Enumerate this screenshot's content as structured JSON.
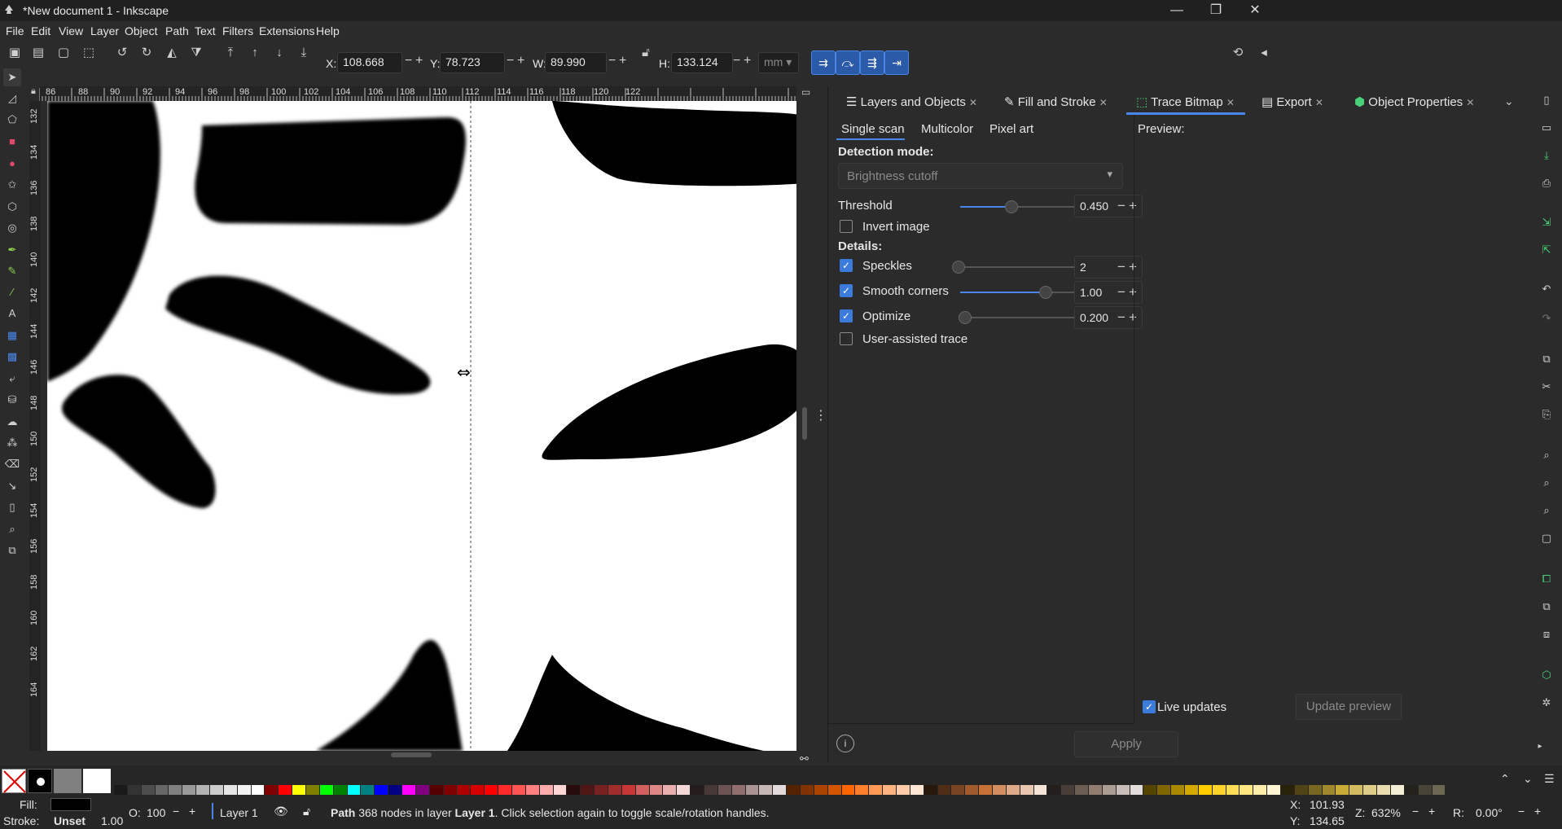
{
  "window": {
    "title": "*New document 1 - Inkscape",
    "minimize_glyph": "—",
    "restore_glyph": "❐",
    "close_glyph": "✕"
  },
  "menu": [
    "File",
    "Edit",
    "View",
    "Layer",
    "Object",
    "Path",
    "Text",
    "Filters",
    "Extensions",
    "Help"
  ],
  "toolbar": {
    "x_label": "X:",
    "x_value": "108.668",
    "y_label": "Y:",
    "y_value": "78.723",
    "w_label": "W:",
    "w_value": "89.990",
    "h_label": "H:",
    "h_value": "133.124",
    "unit": "mm",
    "minus": "−",
    "plus": "+"
  },
  "ruler": {
    "h_labels": [
      "86",
      "88",
      "90",
      "92",
      "94",
      "96",
      "98",
      "100",
      "102",
      "104",
      "106",
      "108",
      "110",
      "112",
      "114",
      "116",
      "118",
      "120",
      "122"
    ],
    "v_labels": [
      "132",
      "134",
      "136",
      "138",
      "140",
      "142",
      "144",
      "146",
      "148",
      "150",
      "152",
      "154",
      "156",
      "158",
      "160",
      "162",
      "164"
    ]
  },
  "panel": {
    "tabs": [
      {
        "label": "Layers and Objects",
        "icon": "layers-icon"
      },
      {
        "label": "Fill and Stroke",
        "icon": "fill-stroke-icon"
      },
      {
        "label": "Trace Bitmap",
        "icon": "trace-bitmap-icon"
      },
      {
        "label": "Export",
        "icon": "export-icon"
      },
      {
        "label": "Object Properties",
        "icon": "object-properties-icon"
      }
    ],
    "close_glyph": "✕",
    "sub_tabs": [
      "Single scan",
      "Multicolor",
      "Pixel art"
    ],
    "detection_mode_label": "Detection mode:",
    "detection_mode_value": "Brightness cutoff",
    "threshold_label": "Threshold",
    "threshold_value": "0.450",
    "threshold_level": 0.45,
    "invert_label": "Invert image",
    "invert_checked": false,
    "details_label": "Details:",
    "speckles_label": "Speckles",
    "speckles_value": "2",
    "speckles_checked": true,
    "speckles_level": 0.0,
    "smooth_label": "Smooth corners",
    "smooth_value": "1.00",
    "smooth_checked": true,
    "smooth_level": 0.75,
    "optimize_label": "Optimize",
    "optimize_value": "0.200",
    "optimize_checked": true,
    "optimize_level": 0.04,
    "user_assisted_label": "User-assisted trace",
    "user_assisted_checked": false,
    "preview_label": "Preview:",
    "live_updates_label": "Live updates",
    "live_updates_checked": true,
    "update_preview_label": "Update preview",
    "apply_label": "Apply",
    "info_glyph": "i"
  },
  "status": {
    "fill_label": "Fill:",
    "stroke_label": "Stroke:",
    "stroke_value": "Unset",
    "stroke_width": "1.00",
    "opacity_label": "O:",
    "opacity_value": "100",
    "layer_name": "Layer 1",
    "message_bold1": "Path",
    "message_part1": " 368 nodes in layer ",
    "message_bold2": "Layer 1",
    "message_part2": ". Click selection again to toggle scale/rotation handles.",
    "x_label": "X:",
    "x_value": "101.93",
    "y_label": "Y:",
    "y_value": "134.65",
    "zoom_label": "Z:",
    "zoom_value": "632%",
    "rotate_label": "R:",
    "rotate_value": "0.00°"
  },
  "palette_colors": [
    "#1a1a1a",
    "#333333",
    "#4d4d4d",
    "#666666",
    "#808080",
    "#999999",
    "#b3b3b3",
    "#cccccc",
    "#e6e6e6",
    "#f2f2f2",
    "#ffffff",
    "#800000",
    "#ff0000",
    "#ffff00",
    "#808000",
    "#00ff00",
    "#008000",
    "#00ffff",
    "#008080",
    "#0000ff",
    "#000080",
    "#ff00ff",
    "#800080",
    "#550000",
    "#800000",
    "#aa0000",
    "#d40000",
    "#ff0000",
    "#ff2a2a",
    "#ff5555",
    "#ff8080",
    "#ffaaaa",
    "#ffd5d5",
    "#280b0b",
    "#501616",
    "#782121",
    "#a02c2c",
    "#c83737",
    "#d35f5f",
    "#de8787",
    "#e9afaf",
    "#f4d7d7",
    "#241c1c",
    "#483737",
    "#6c5353",
    "#916f6f",
    "#ac9393",
    "#c8b7b7",
    "#e3dbdb",
    "#552200",
    "#803300",
    "#aa4400",
    "#d45500",
    "#ff6600",
    "#ff7f2a",
    "#ff9955",
    "#ffb380",
    "#ffccaa",
    "#ffe6d5",
    "#28170b",
    "#502d16",
    "#784421",
    "#a05a2c",
    "#c87137",
    "#d38d5f",
    "#deaa87",
    "#e9c6af",
    "#f4e3d7",
    "#241f1c",
    "#483e37",
    "#6c5d53",
    "#917c6f",
    "#ac9d93",
    "#c8beb7",
    "#e3dedb",
    "#554400",
    "#806600",
    "#aa8800",
    "#d4aa00",
    "#ffcc00",
    "#ffd42a",
    "#ffdd55",
    "#ffe680",
    "#ffeeaa",
    "#fff6d5",
    "#28220b",
    "#504416",
    "#786721",
    "#a0892c",
    "#c8ab37",
    "#d3bc5f",
    "#decd87",
    "#e9ddaf",
    "#f4eed7",
    "#24221c",
    "#484537",
    "#6c6753"
  ]
}
